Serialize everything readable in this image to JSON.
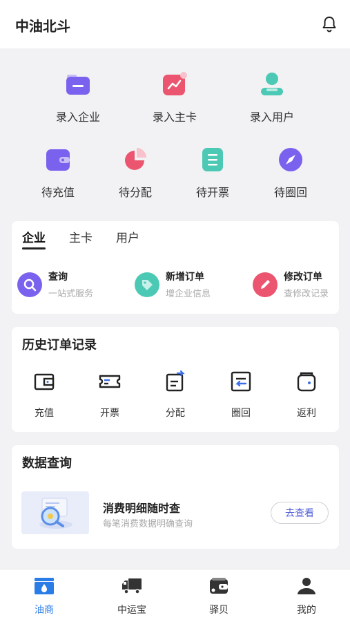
{
  "header": {
    "title": "中油北斗",
    "icon": "bell-icon"
  },
  "quick_actions": {
    "row1": [
      {
        "label": "录入企业",
        "icon": "enterprise-folder-icon",
        "color": "#7b62ee"
      },
      {
        "label": "录入主卡",
        "icon": "trend-card-icon",
        "color": "#ec5570"
      },
      {
        "label": "录入用户",
        "icon": "user-icon",
        "color": "#4cc9b5"
      }
    ],
    "row2": [
      {
        "label": "待充值",
        "icon": "wallet-icon",
        "color": "#7b62ee"
      },
      {
        "label": "待分配",
        "icon": "pie-chart-icon",
        "color": "#ec5570"
      },
      {
        "label": "待开票",
        "icon": "document-icon",
        "color": "#4cc9b5"
      },
      {
        "label": "待圈回",
        "icon": "compass-icon",
        "color": "#7b62ee"
      }
    ]
  },
  "tab_card": {
    "tabs": [
      "企业",
      "主卡",
      "用户"
    ],
    "active_tab": "企业",
    "actions": [
      {
        "title": "查询",
        "subtitle": "一站式服务",
        "icon": "search-icon",
        "color": "#7b62ee"
      },
      {
        "title": "新增订单",
        "subtitle": "增企业信息",
        "icon": "tag-icon",
        "color": "#4cc9b5"
      },
      {
        "title": "修改订单",
        "subtitle": "查修改记录",
        "icon": "pencil-icon",
        "color": "#ec5570"
      }
    ]
  },
  "history": {
    "title": "历史订单记录",
    "items": [
      {
        "label": "充值",
        "icon": "wallet-outline-icon"
      },
      {
        "label": "开票",
        "icon": "ticket-icon"
      },
      {
        "label": "分配",
        "icon": "share-doc-icon"
      },
      {
        "label": "圈回",
        "icon": "return-icon"
      },
      {
        "label": "返利",
        "icon": "rebate-wallet-icon"
      }
    ]
  },
  "data_query": {
    "title": "数据查询",
    "item_title": "消费明细随时查",
    "item_subtitle": "每笔消费数据明确查询",
    "button_label": "去查看",
    "accent": "#5563d9"
  },
  "bottom_nav": {
    "active": "油商",
    "items": [
      {
        "label": "油商",
        "icon": "oil-merchant-icon"
      },
      {
        "label": "中运宝",
        "icon": "truck-icon"
      },
      {
        "label": "驿贝",
        "icon": "wallet-nav-icon"
      },
      {
        "label": "我的",
        "icon": "profile-icon"
      }
    ]
  }
}
